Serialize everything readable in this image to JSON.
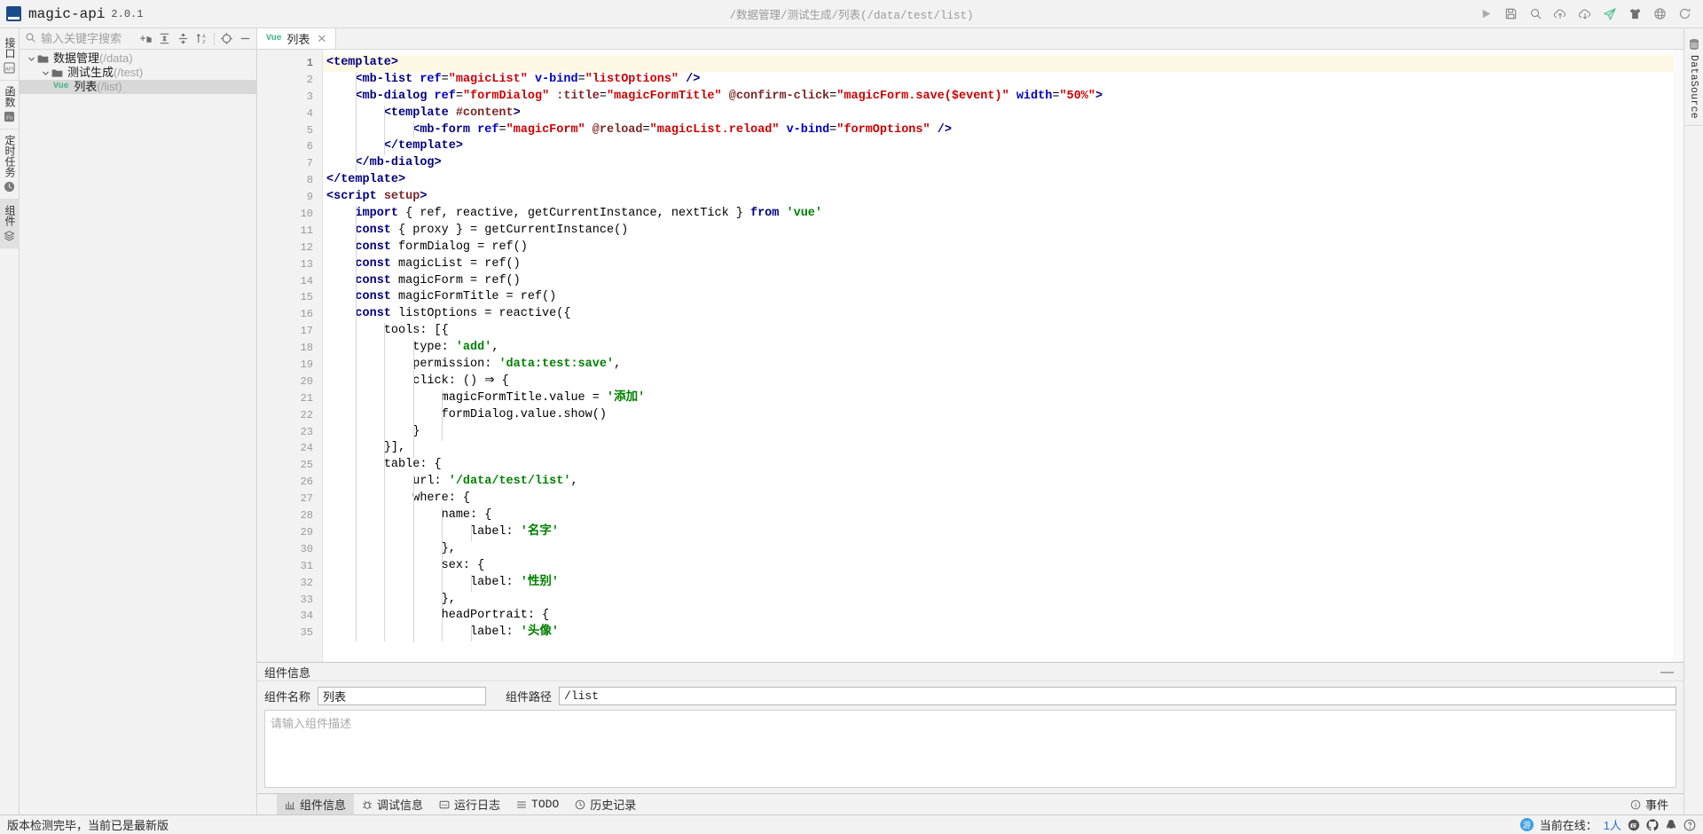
{
  "app": {
    "logo_text": "MA",
    "name": "magic-api",
    "version": "2.0.1",
    "current_path": "/数据管理/测试生成/列表(/data/test/list)"
  },
  "titlebar_actions": [
    {
      "name": "run-icon",
      "title": "运行"
    },
    {
      "name": "save-icon",
      "title": "保存"
    },
    {
      "name": "search-icon",
      "title": "搜索"
    },
    {
      "name": "cloud-upload-icon",
      "title": "上传"
    },
    {
      "name": "cloud-download-icon",
      "title": "下载"
    },
    {
      "name": "send-icon",
      "title": "推送"
    },
    {
      "name": "theme-shirt-icon",
      "title": "主题"
    },
    {
      "name": "globe-icon",
      "title": "语言"
    },
    {
      "name": "refresh-icon",
      "title": "刷新"
    }
  ],
  "left_strip": {
    "items": [
      {
        "label": "接口",
        "icon": "api-icon",
        "active": false
      },
      {
        "label": "函数",
        "icon": "fn-icon",
        "active": false
      },
      {
        "label": "定时任务",
        "icon": "clock-icon",
        "active": false
      },
      {
        "label": "组件",
        "icon": "layers-icon",
        "active": true
      }
    ]
  },
  "right_strip": {
    "items": [
      {
        "label": "DataSource",
        "icon": "database-icon",
        "active": false
      }
    ]
  },
  "tree_panel": {
    "search": {
      "placeholder": "输入关键字搜索",
      "value": ""
    },
    "toolbar": [
      {
        "name": "new-folder-icon",
        "title": "新建分组"
      },
      {
        "name": "collapse-all-icon",
        "title": "全部折叠"
      },
      {
        "name": "expand-all-icon",
        "title": "全部展开"
      },
      {
        "name": "sort-az-icon",
        "title": "排序"
      },
      {
        "name": "locate-icon",
        "title": "定位"
      },
      {
        "name": "minimize-icon",
        "title": "收起"
      }
    ],
    "nodes": [
      {
        "depth": 0,
        "expanded": true,
        "type": "folder",
        "label": "数据管理",
        "path": "(/data)",
        "selected": false
      },
      {
        "depth": 1,
        "expanded": true,
        "type": "folder",
        "label": "测试生成",
        "path": "(/test)",
        "selected": false
      },
      {
        "depth": 2,
        "expanded": null,
        "type": "vue",
        "badge": "Vue",
        "label": "列表",
        "path": "(/list)",
        "selected": true
      }
    ]
  },
  "editor_tabs": [
    {
      "badge": "Vue",
      "label": "列表",
      "active": true,
      "close": "✕"
    }
  ],
  "editor": {
    "cursor_line": 1,
    "total_lines": 35,
    "lines": [
      {
        "n": 1,
        "indent": 0,
        "tokens": [
          {
            "t": "tag",
            "v": "<template>"
          }
        ]
      },
      {
        "n": 2,
        "indent": 1,
        "tokens": [
          {
            "t": "tag",
            "v": "<mb-list "
          },
          {
            "t": "attr",
            "v": "ref"
          },
          {
            "t": "punc",
            "v": "="
          },
          {
            "t": "strq",
            "v": "\"magicList\""
          },
          {
            "t": "plain",
            "v": " "
          },
          {
            "t": "attr",
            "v": "v-bind"
          },
          {
            "t": "punc",
            "v": "="
          },
          {
            "t": "strq",
            "v": "\"listOptions\""
          },
          {
            "t": "plain",
            "v": " "
          },
          {
            "t": "tag",
            "v": "/>"
          }
        ]
      },
      {
        "n": 3,
        "indent": 1,
        "tokens": [
          {
            "t": "tag",
            "v": "<mb-dialog "
          },
          {
            "t": "attr",
            "v": "ref"
          },
          {
            "t": "punc",
            "v": "="
          },
          {
            "t": "strq",
            "v": "\"formDialog\""
          },
          {
            "t": "plain",
            "v": " "
          },
          {
            "t": "attr2",
            "v": ":title"
          },
          {
            "t": "punc",
            "v": "="
          },
          {
            "t": "strq",
            "v": "\"magicFormTitle\""
          },
          {
            "t": "plain",
            "v": " "
          },
          {
            "t": "attr2",
            "v": "@confirm-click"
          },
          {
            "t": "punc",
            "v": "="
          },
          {
            "t": "strq",
            "v": "\"magicForm.save($event)\""
          },
          {
            "t": "plain",
            "v": " "
          },
          {
            "t": "attr",
            "v": "width"
          },
          {
            "t": "punc",
            "v": "="
          },
          {
            "t": "strq",
            "v": "\"50%\""
          },
          {
            "t": "tag",
            "v": ">"
          }
        ]
      },
      {
        "n": 4,
        "indent": 2,
        "tokens": [
          {
            "t": "tag",
            "v": "<template "
          },
          {
            "t": "attr2",
            "v": "#content"
          },
          {
            "t": "tag",
            "v": ">"
          }
        ]
      },
      {
        "n": 5,
        "indent": 3,
        "tokens": [
          {
            "t": "tag",
            "v": "<mb-form "
          },
          {
            "t": "attr",
            "v": "ref"
          },
          {
            "t": "punc",
            "v": "="
          },
          {
            "t": "strq",
            "v": "\"magicForm\""
          },
          {
            "t": "plain",
            "v": " "
          },
          {
            "t": "attr2",
            "v": "@reload"
          },
          {
            "t": "punc",
            "v": "="
          },
          {
            "t": "strq",
            "v": "\"magicList.reload\""
          },
          {
            "t": "plain",
            "v": " "
          },
          {
            "t": "attr",
            "v": "v-bind"
          },
          {
            "t": "punc",
            "v": "="
          },
          {
            "t": "strq",
            "v": "\"formOptions\""
          },
          {
            "t": "plain",
            "v": " "
          },
          {
            "t": "tag",
            "v": "/>"
          }
        ]
      },
      {
        "n": 6,
        "indent": 2,
        "tokens": [
          {
            "t": "tag",
            "v": "</template>"
          }
        ]
      },
      {
        "n": 7,
        "indent": 1,
        "tokens": [
          {
            "t": "tag",
            "v": "</mb-dialog>"
          }
        ]
      },
      {
        "n": 8,
        "indent": 0,
        "tokens": [
          {
            "t": "tag",
            "v": "</template>"
          }
        ]
      },
      {
        "n": 9,
        "indent": 0,
        "tokens": [
          {
            "t": "tag",
            "v": "<script "
          },
          {
            "t": "attr2",
            "v": "setup"
          },
          {
            "t": "tag",
            "v": ">"
          }
        ]
      },
      {
        "n": 10,
        "indent": 1,
        "tokens": [
          {
            "t": "kw",
            "v": "import"
          },
          {
            "t": "plain",
            "v": " { ref, reactive, getCurrentInstance, nextTick } "
          },
          {
            "t": "kw",
            "v": "from"
          },
          {
            "t": "plain",
            "v": " "
          },
          {
            "t": "str",
            "v": "'vue'"
          }
        ]
      },
      {
        "n": 11,
        "indent": 1,
        "tokens": [
          {
            "t": "kw",
            "v": "const"
          },
          {
            "t": "plain",
            "v": " { proxy } = getCurrentInstance()"
          }
        ]
      },
      {
        "n": 12,
        "indent": 1,
        "tokens": [
          {
            "t": "kw",
            "v": "const"
          },
          {
            "t": "plain",
            "v": " formDialog = ref()"
          }
        ]
      },
      {
        "n": 13,
        "indent": 1,
        "tokens": [
          {
            "t": "kw",
            "v": "const"
          },
          {
            "t": "plain",
            "v": " magicList = ref()"
          }
        ]
      },
      {
        "n": 14,
        "indent": 1,
        "tokens": [
          {
            "t": "kw",
            "v": "const"
          },
          {
            "t": "plain",
            "v": " magicForm = ref()"
          }
        ]
      },
      {
        "n": 15,
        "indent": 1,
        "tokens": [
          {
            "t": "kw",
            "v": "const"
          },
          {
            "t": "plain",
            "v": " magicFormTitle = ref()"
          }
        ]
      },
      {
        "n": 16,
        "indent": 1,
        "tokens": [
          {
            "t": "kw",
            "v": "const"
          },
          {
            "t": "plain",
            "v": " listOptions = reactive({"
          }
        ]
      },
      {
        "n": 17,
        "indent": 2,
        "tokens": [
          {
            "t": "plain",
            "v": "tools: [{"
          }
        ]
      },
      {
        "n": 18,
        "indent": 3,
        "tokens": [
          {
            "t": "plain",
            "v": "type: "
          },
          {
            "t": "str",
            "v": "'add'"
          },
          {
            "t": "plain",
            "v": ","
          }
        ]
      },
      {
        "n": 19,
        "indent": 3,
        "tokens": [
          {
            "t": "plain",
            "v": "permission: "
          },
          {
            "t": "str",
            "v": "'data:test:save'"
          },
          {
            "t": "plain",
            "v": ","
          }
        ]
      },
      {
        "n": 20,
        "indent": 3,
        "tokens": [
          {
            "t": "plain",
            "v": "click: () ⇒ {"
          }
        ]
      },
      {
        "n": 21,
        "indent": 4,
        "tokens": [
          {
            "t": "plain",
            "v": "magicFormTitle.value = "
          },
          {
            "t": "str",
            "v": "'添加'"
          }
        ]
      },
      {
        "n": 22,
        "indent": 4,
        "tokens": [
          {
            "t": "plain",
            "v": "formDialog.value.show()"
          }
        ]
      },
      {
        "n": 23,
        "indent": 3,
        "tokens": [
          {
            "t": "plain",
            "v": "}"
          }
        ]
      },
      {
        "n": 24,
        "indent": 2,
        "tokens": [
          {
            "t": "plain",
            "v": "}],"
          }
        ]
      },
      {
        "n": 25,
        "indent": 2,
        "tokens": [
          {
            "t": "plain",
            "v": "table: {"
          }
        ]
      },
      {
        "n": 26,
        "indent": 3,
        "tokens": [
          {
            "t": "plain",
            "v": "url: "
          },
          {
            "t": "str",
            "v": "'/data/test/list'"
          },
          {
            "t": "plain",
            "v": ","
          }
        ]
      },
      {
        "n": 27,
        "indent": 3,
        "tokens": [
          {
            "t": "plain",
            "v": "where: {"
          }
        ]
      },
      {
        "n": 28,
        "indent": 4,
        "tokens": [
          {
            "t": "plain",
            "v": "name: {"
          }
        ]
      },
      {
        "n": 29,
        "indent": 5,
        "tokens": [
          {
            "t": "plain",
            "v": "label: "
          },
          {
            "t": "str",
            "v": "'名字'"
          }
        ]
      },
      {
        "n": 30,
        "indent": 4,
        "tokens": [
          {
            "t": "plain",
            "v": "},"
          }
        ]
      },
      {
        "n": 31,
        "indent": 4,
        "tokens": [
          {
            "t": "plain",
            "v": "sex: {"
          }
        ]
      },
      {
        "n": 32,
        "indent": 5,
        "tokens": [
          {
            "t": "plain",
            "v": "label: "
          },
          {
            "t": "str",
            "v": "'性别'"
          }
        ]
      },
      {
        "n": 33,
        "indent": 4,
        "tokens": [
          {
            "t": "plain",
            "v": "},"
          }
        ]
      },
      {
        "n": 34,
        "indent": 4,
        "tokens": [
          {
            "t": "plain",
            "v": "headPortrait: {"
          }
        ]
      },
      {
        "n": 35,
        "indent": 5,
        "tokens": [
          {
            "t": "plain",
            "v": "label: "
          },
          {
            "t": "str",
            "v": "'头像'"
          }
        ]
      }
    ]
  },
  "bottom_panel": {
    "title": "组件信息",
    "collapse_glyph": "—",
    "name_label": "组件名称",
    "name_value": "列表",
    "path_label": "组件路径",
    "path_value": "/list",
    "desc_placeholder": "请输入组件描述",
    "desc_value": ""
  },
  "bottom_tabs": [
    {
      "label": "组件信息",
      "icon": "info-panel-icon",
      "active": true
    },
    {
      "label": "调试信息",
      "icon": "debug-icon",
      "active": false
    },
    {
      "label": "运行日志",
      "icon": "log-icon",
      "active": false
    },
    {
      "label": "TODO",
      "icon": "todo-icon",
      "active": false
    },
    {
      "label": "历史记录",
      "icon": "history-icon",
      "active": false
    }
  ],
  "bottom_tabs_right": {
    "label": "事件",
    "icon": "info-circle-icon"
  },
  "statusbar": {
    "message": "版本检测完毕，当前已是最新版",
    "avatar_text": "游",
    "online_label": "当前在线：",
    "online_count": "1人",
    "icons": [
      {
        "name": "gitee-icon"
      },
      {
        "name": "github-icon"
      },
      {
        "name": "qq-icon"
      },
      {
        "name": "help-icon"
      }
    ]
  },
  "colors": {
    "accent": "#41b883",
    "chrome": "#f2f2f2",
    "editor_bg": "#ffffff",
    "cur_line": "#fdf8e3",
    "link": "#2b6fd1"
  }
}
